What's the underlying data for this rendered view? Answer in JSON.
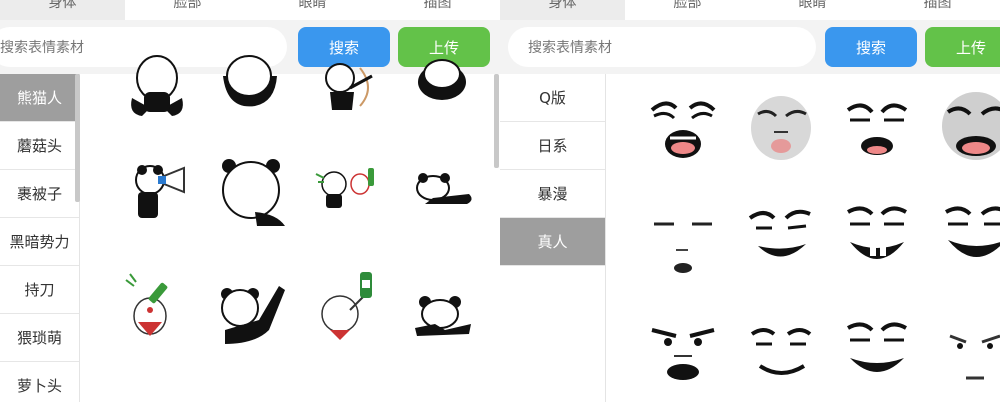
{
  "left": {
    "tabs": [
      {
        "label": "身体",
        "active": true
      },
      {
        "label": "脸部",
        "active": false
      },
      {
        "label": "眼睛",
        "active": false
      },
      {
        "label": "插图",
        "active": false
      }
    ],
    "search": {
      "placeholder": "搜索表情素材",
      "search_label": "搜索",
      "upload_label": "上传"
    },
    "sidebar": [
      {
        "label": "熊猫人",
        "active": true
      },
      {
        "label": "蘑菇头",
        "active": false
      },
      {
        "label": "裹被子",
        "active": false
      },
      {
        "label": "黑暗势力",
        "active": false
      },
      {
        "label": "持刀",
        "active": false
      },
      {
        "label": "猥琐萌",
        "active": false
      },
      {
        "label": "萝卜头",
        "active": false
      }
    ],
    "stickers": [
      "panda-sticker",
      "panda-sticker",
      "panda-sticker",
      "panda-sticker",
      "panda-sticker",
      "panda-sticker",
      "panda-sticker",
      "panda-sticker",
      "panda-sticker",
      "panda-sticker",
      "panda-sticker",
      "panda-sticker"
    ]
  },
  "right": {
    "tabs": [
      {
        "label": "身体",
        "active": true
      },
      {
        "label": "脸部",
        "active": false
      },
      {
        "label": "眼睛",
        "active": false
      },
      {
        "label": "插图",
        "active": false
      }
    ],
    "search": {
      "placeholder": "搜索表情素材",
      "search_label": "搜索",
      "upload_label": "上传"
    },
    "sidebar": [
      {
        "label": "Q版",
        "active": false
      },
      {
        "label": "日系",
        "active": false
      },
      {
        "label": "暴漫",
        "active": false
      },
      {
        "label": "真人",
        "active": true
      }
    ],
    "faces": [
      "face-sticker",
      "face-sticker",
      "face-sticker",
      "face-sticker",
      "face-sticker",
      "face-sticker",
      "face-sticker",
      "face-sticker",
      "face-sticker",
      "face-sticker",
      "face-sticker",
      "face-sticker"
    ]
  },
  "colors": {
    "search_button": "#3a97ee",
    "upload_button": "#63c249",
    "active_side": "#9e9e9e"
  }
}
